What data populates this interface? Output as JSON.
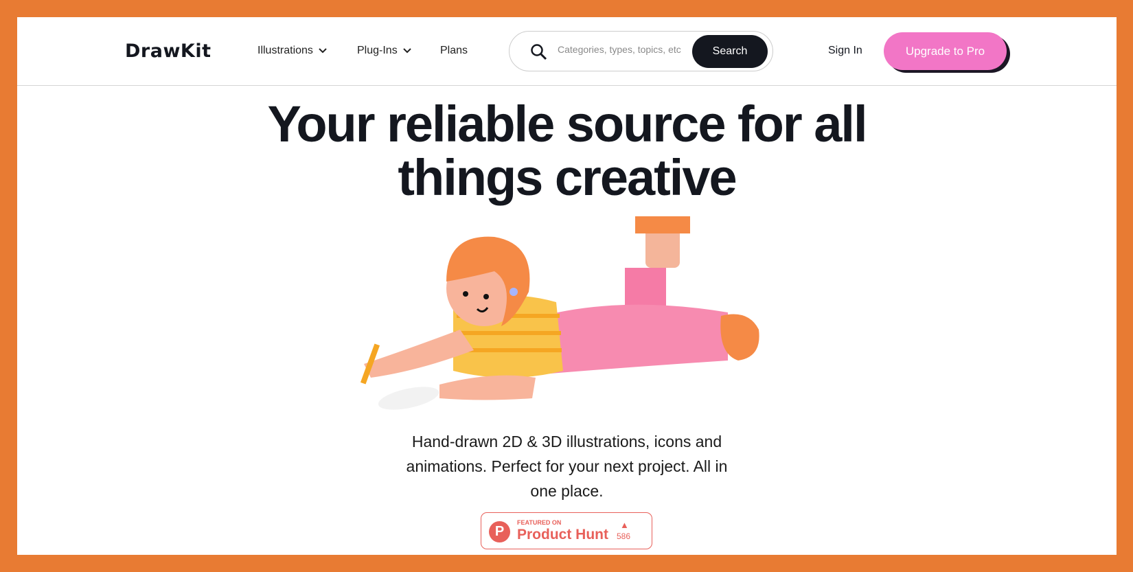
{
  "header": {
    "logo": "DrawKit",
    "nav": [
      {
        "label": "Illustrations",
        "has_dropdown": true
      },
      {
        "label": "Plug-Ins",
        "has_dropdown": true
      },
      {
        "label": "Plans",
        "has_dropdown": false
      }
    ],
    "search": {
      "placeholder": "Categories, types, topics, etc",
      "button": "Search"
    },
    "sign_in": "Sign In",
    "upgrade": "Upgrade to Pro"
  },
  "hero": {
    "title_line1": "Your reliable source for all",
    "title_line2": "things creative",
    "subtitle": [
      "Hand-drawn 2D & 3D illustrations, icons and",
      "animations. Perfect for your next project. All in",
      "one place."
    ]
  },
  "badge": {
    "featured": "FEATURED ON",
    "name": "Product Hunt",
    "icon_letter": "P",
    "count": "586"
  },
  "colors": {
    "frame": "#e87b33",
    "accent": "#f276c6",
    "dark": "#14171f",
    "product_hunt": "#e8605a"
  }
}
